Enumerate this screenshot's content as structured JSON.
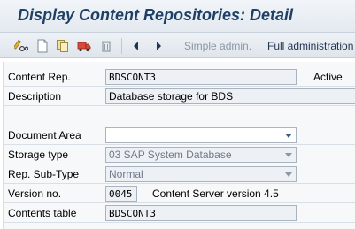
{
  "window": {
    "title": "Display Content Repositories: Detail"
  },
  "toolbar": {
    "icons": [
      "pencil-glasses-icon",
      "new-document-icon",
      "copy-icon",
      "transport-icon",
      "delete-icon",
      "previous-icon",
      "next-icon"
    ],
    "simple_admin_label": "Simple admin.",
    "full_admin_label": "Full administration"
  },
  "form": {
    "content_rep": {
      "label": "Content Rep.",
      "value": "BDSCONT3",
      "status": "Active"
    },
    "description": {
      "label": "Description",
      "value": "Database storage for BDS"
    },
    "document_area": {
      "label": "Document Area",
      "value": ""
    },
    "storage_type": {
      "label": "Storage type",
      "value": "03 SAP System Database"
    },
    "rep_sub_type": {
      "label": "Rep. Sub-Type",
      "value": "Normal"
    },
    "version_no": {
      "label": "Version no.",
      "value": "0045",
      "info": "Content Server version 4.5"
    },
    "contents_table": {
      "label": "Contents table",
      "value": "BDSCONT3"
    }
  },
  "colors": {
    "title": "#1f3f66",
    "toolbar_text": "#1f3550",
    "disabled_text": "#8a96a4"
  }
}
